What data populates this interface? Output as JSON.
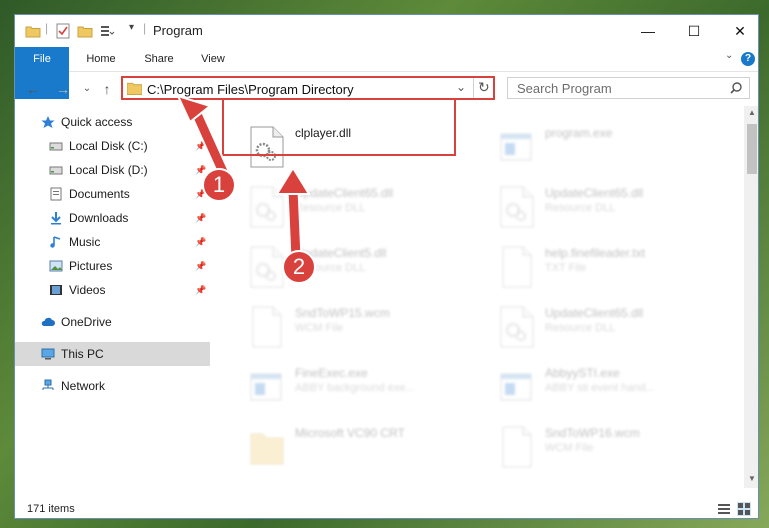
{
  "window": {
    "title": "Program",
    "controls": {
      "minimize": "—",
      "maximize": "☐",
      "close": "✕"
    }
  },
  "ribbon": {
    "tabs": [
      "File",
      "Home",
      "Share",
      "View"
    ],
    "help": "?"
  },
  "address": {
    "path": "C:\\Program Files\\Program Directory",
    "search_placeholder": "Search Program"
  },
  "sidebar": {
    "items": [
      {
        "label": "Quick access",
        "icon": "star-icon",
        "pinned": false
      },
      {
        "label": "Local Disk (C:)",
        "icon": "drive-icon",
        "pinned": true
      },
      {
        "label": "Local Disk (D:)",
        "icon": "drive-icon",
        "pinned": true
      },
      {
        "label": "Documents",
        "icon": "documents-icon",
        "pinned": true
      },
      {
        "label": "Downloads",
        "icon": "download-icon",
        "pinned": true
      },
      {
        "label": "Music",
        "icon": "music-icon",
        "pinned": true
      },
      {
        "label": "Pictures",
        "icon": "pictures-icon",
        "pinned": true
      },
      {
        "label": "Videos",
        "icon": "videos-icon",
        "pinned": true
      },
      {
        "label": "OneDrive",
        "icon": "cloud-icon",
        "pinned": false
      },
      {
        "label": "This PC",
        "icon": "computer-icon",
        "pinned": false,
        "selected": true
      },
      {
        "label": "Network",
        "icon": "network-icon",
        "pinned": false
      }
    ]
  },
  "files": [
    {
      "name": "clplayer.dll",
      "type": "",
      "highlighted": true
    },
    {
      "name": "program.exe",
      "type": ""
    },
    {
      "name": "UpdateClient65.dll",
      "type": "Resource DLL"
    },
    {
      "name": "UpdateClient65.dll",
      "type": "Resource DLL"
    },
    {
      "name": "UpdateClient5.dll",
      "type": "Resource DLL"
    },
    {
      "name": "help.finefileader.txt",
      "type": "TXT File"
    },
    {
      "name": "SndToWP15.wcm",
      "type": "WCM File"
    },
    {
      "name": "UpdateClient65.dll",
      "type": "Resource DLL"
    },
    {
      "name": "FineExec.exe",
      "type": "ABBY background exe..."
    },
    {
      "name": "AbbyySTI.exe",
      "type": "ABBY sti event hand..."
    },
    {
      "name": "Microsoft VC90 CRT",
      "type": ""
    },
    {
      "name": "SndToWP16.wcm",
      "type": "WCM File"
    }
  ],
  "status": {
    "items": "171 items"
  },
  "annotations": {
    "badge1": "1",
    "badge2": "2"
  },
  "colors": {
    "accent": "#1979ca",
    "highlight": "#d9413d"
  }
}
